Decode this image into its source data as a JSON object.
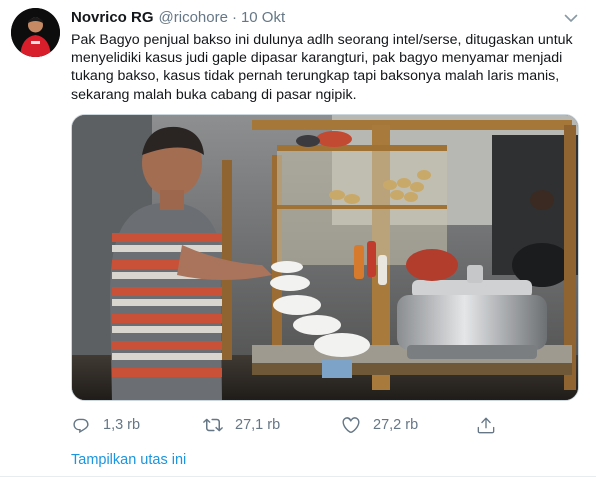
{
  "tweet": {
    "author_name": "Novrico RG",
    "author_handle": "@ricohore",
    "separator": "·",
    "timestamp": "10 Okt",
    "text": "Pak Bagyo penjual bakso ini dulunya adlh seorang intel/serse, ditugaskan untuk menyelidiki kasus judi gaple dipasar karangturi, pak bagyo menyamar menjadi tukang bakso, kasus tidak pernah terungkap tapi baksonya malah laris manis, sekarang malah buka cabang di pasar ngipik.",
    "media_icon": "photo-bakso-vendor"
  },
  "actions": {
    "reply": {
      "icon": "reply-icon",
      "count": "1,3 rb"
    },
    "retweet": {
      "icon": "retweet-icon",
      "count": "27,1 rb"
    },
    "like": {
      "icon": "heart-icon",
      "count": "27,2 rb"
    },
    "share": {
      "icon": "share-icon"
    }
  },
  "thread_link": "Tampilkan utas ini",
  "colors": {
    "text": "#14171a",
    "secondary": "#657786",
    "link": "#1b95e0",
    "border": "#e6ecf0"
  }
}
